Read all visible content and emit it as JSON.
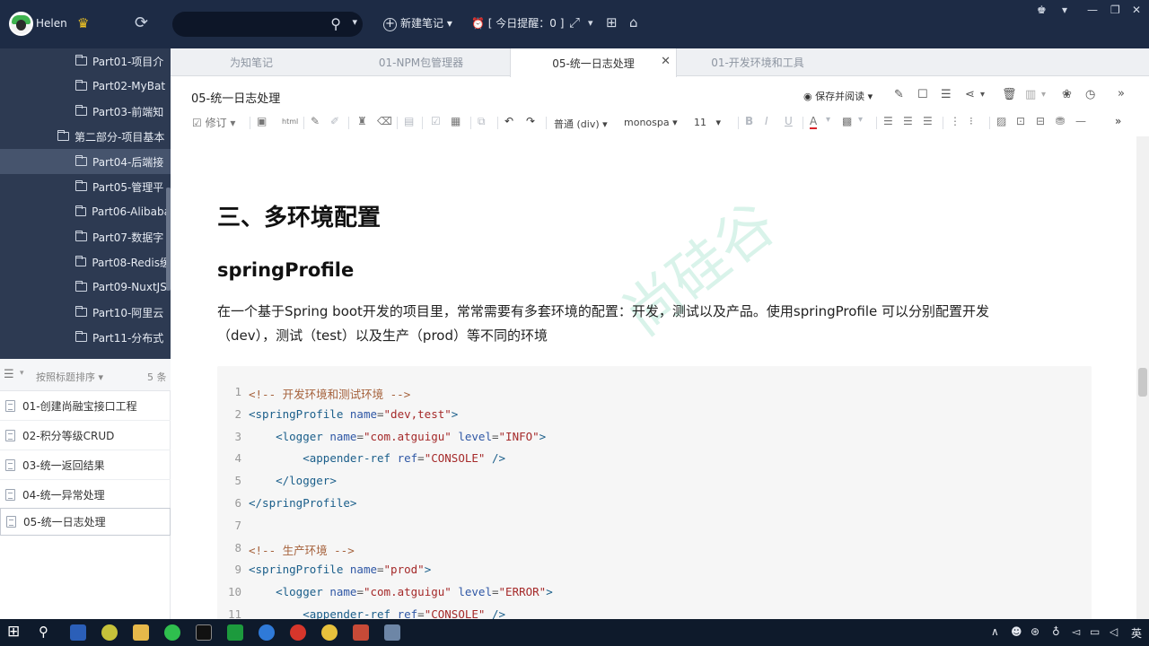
{
  "app": {
    "username": "Helen",
    "new_note_label": "新建笔记",
    "reminder_label": "[ 今日提醒：0 ]"
  },
  "sidebar": {
    "tree": [
      {
        "label": "Part01-项目介",
        "level": 2
      },
      {
        "label": "Part02-MyBat",
        "level": 2
      },
      {
        "label": "Part03-前端知",
        "level": 2
      },
      {
        "label": "第二部分-项目基本",
        "level": 1
      },
      {
        "label": "Part04-后端接",
        "level": 2,
        "selected": true
      },
      {
        "label": "Part05-管理平",
        "level": 2
      },
      {
        "label": "Part06-Alibaba",
        "level": 2
      },
      {
        "label": "Part07-数据字",
        "level": 2
      },
      {
        "label": "Part08-Redis缓",
        "level": 2
      },
      {
        "label": "Part09-NuxtJS",
        "level": 2
      },
      {
        "label": "Part10-阿里云",
        "level": 2
      },
      {
        "label": "Part11-分布式",
        "level": 2
      }
    ],
    "sort_label": "按照标题排序",
    "count_label": "5 条",
    "notes": [
      {
        "label": "01-创建尚融宝接口工程"
      },
      {
        "label": "02-积分等级CRUD"
      },
      {
        "label": "03-统一返回结果"
      },
      {
        "label": "04-统一异常处理"
      },
      {
        "label": "05-统一日志处理",
        "active": true
      }
    ]
  },
  "tabs": [
    {
      "label": "为知笔记"
    },
    {
      "label": "01-NPM包管理器"
    },
    {
      "label": "05-统一日志处理",
      "active": true
    },
    {
      "label": "01-开发环境和工具"
    }
  ],
  "note": {
    "title": "05-统一日志处理",
    "read_button": "保存并阅读"
  },
  "toolbar": {
    "revise": "修订",
    "html": "html",
    "paragraph": "普通 (div)",
    "font": "monospa",
    "size": "11"
  },
  "content": {
    "h3": "三、多环境配置",
    "h4": "springProfile",
    "para_line1": "在一个基于Spring boot开发的项目里，常常需要有多套环境的配置：开发，测试以及产品。使用springProfile 可以分别配置开发",
    "para_line2": "（dev），测试（test）以及生产（prod）等不同的环境",
    "watermark": "尚硅谷",
    "code": [
      {
        "n": "1",
        "parts": [
          [
            "c-comment",
            "<!-- 开发环境和测试环境 -->"
          ]
        ]
      },
      {
        "n": "2",
        "parts": [
          [
            "c-tag",
            "<springProfile"
          ],
          [
            "c-punc",
            " "
          ],
          [
            "c-attr",
            "name"
          ],
          [
            "c-punc",
            "="
          ],
          [
            "c-val",
            "\"dev,test\""
          ],
          [
            "c-tag",
            ">"
          ]
        ]
      },
      {
        "n": "3",
        "parts": [
          [
            "c-punc",
            "    "
          ],
          [
            "c-tag",
            "<logger"
          ],
          [
            "c-punc",
            " "
          ],
          [
            "c-attr",
            "name"
          ],
          [
            "c-punc",
            "="
          ],
          [
            "c-val",
            "\"com.atguigu\""
          ],
          [
            "c-punc",
            " "
          ],
          [
            "c-attr",
            "level"
          ],
          [
            "c-punc",
            "="
          ],
          [
            "c-val",
            "\"INFO\""
          ],
          [
            "c-tag",
            ">"
          ]
        ]
      },
      {
        "n": "4",
        "parts": [
          [
            "c-punc",
            "        "
          ],
          [
            "c-tag",
            "<appender-ref"
          ],
          [
            "c-punc",
            " "
          ],
          [
            "c-attr",
            "ref"
          ],
          [
            "c-punc",
            "="
          ],
          [
            "c-val",
            "\"CONSOLE\""
          ],
          [
            "c-punc",
            " "
          ],
          [
            "c-tag",
            "/>"
          ]
        ]
      },
      {
        "n": "5",
        "parts": [
          [
            "c-punc",
            "    "
          ],
          [
            "c-tag",
            "</logger>"
          ]
        ]
      },
      {
        "n": "6",
        "parts": [
          [
            "c-tag",
            "</springProfile>"
          ]
        ]
      },
      {
        "n": "7",
        "parts": []
      },
      {
        "n": "8",
        "parts": [
          [
            "c-comment",
            "<!-- 生产环境 -->"
          ]
        ]
      },
      {
        "n": "9",
        "parts": [
          [
            "c-tag",
            "<springProfile"
          ],
          [
            "c-punc",
            " "
          ],
          [
            "c-attr",
            "name"
          ],
          [
            "c-punc",
            "="
          ],
          [
            "c-val",
            "\"prod\""
          ],
          [
            "c-tag",
            ">"
          ]
        ]
      },
      {
        "n": "10",
        "parts": [
          [
            "c-punc",
            "    "
          ],
          [
            "c-tag",
            "<logger"
          ],
          [
            "c-punc",
            " "
          ],
          [
            "c-attr",
            "name"
          ],
          [
            "c-punc",
            "="
          ],
          [
            "c-val",
            "\"com.atguigu\""
          ],
          [
            "c-punc",
            " "
          ],
          [
            "c-attr",
            "level"
          ],
          [
            "c-punc",
            "="
          ],
          [
            "c-val",
            "\"ERROR\""
          ],
          [
            "c-tag",
            ">"
          ]
        ]
      },
      {
        "n": "11",
        "parts": [
          [
            "c-punc",
            "        "
          ],
          [
            "c-tag",
            "<appender-ref"
          ],
          [
            "c-punc",
            " "
          ],
          [
            "c-attr",
            "ref"
          ],
          [
            "c-punc",
            "="
          ],
          [
            "c-val",
            "\"CONSOLE\""
          ],
          [
            "c-punc",
            " "
          ],
          [
            "c-tag",
            "/>"
          ]
        ]
      }
    ]
  },
  "taskbar": {
    "ime": "英"
  },
  "colors": {
    "topbar": "#1d2b45",
    "sidebar": "#2d3a52",
    "accent": "#3fb34f"
  }
}
